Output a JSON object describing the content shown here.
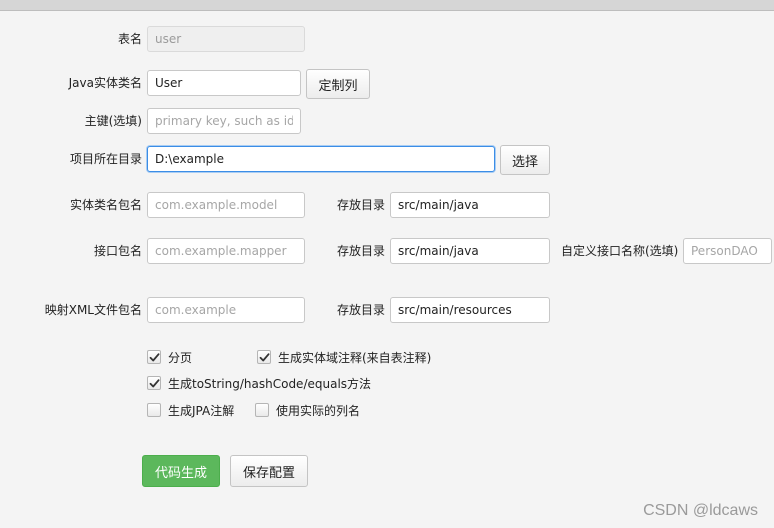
{
  "form": {
    "table_name": {
      "label": "表名",
      "value": "user"
    },
    "entity_class": {
      "label": "Java实体类名",
      "value": "User",
      "button": "定制列"
    },
    "primary_key": {
      "label": "主键(选填)",
      "placeholder": "primary key, such as id"
    },
    "project_dir": {
      "label": "项目所在目录",
      "value": "D:\\example",
      "button": "选择"
    },
    "entity_package": {
      "label": "实体类名包名",
      "placeholder": "com.example.model",
      "dir_label": "存放目录",
      "dir_value": "src/main/java"
    },
    "mapper_package": {
      "label": "接口包名",
      "placeholder": "com.example.mapper",
      "dir_label": "存放目录",
      "dir_value": "src/main/java",
      "custom_label": "自定义接口名称(选填)",
      "custom_placeholder": "PersonDAO"
    },
    "xml_package": {
      "label": "映射XML文件包名",
      "placeholder": "com.example",
      "dir_label": "存放目录",
      "dir_value": "src/main/resources"
    }
  },
  "options": [
    {
      "label": "分页",
      "checked": true
    },
    {
      "label": "生成实体域注释(来自表注释)",
      "checked": true
    },
    {
      "label": "生成toString/hashCode/equals方法",
      "checked": true
    },
    {
      "label": "生成JPA注解",
      "checked": false
    },
    {
      "label": "使用实际的列名",
      "checked": false
    }
  ],
  "actions": {
    "generate": "代码生成",
    "save": "保存配置"
  },
  "watermark": "CSDN @ldcaws"
}
